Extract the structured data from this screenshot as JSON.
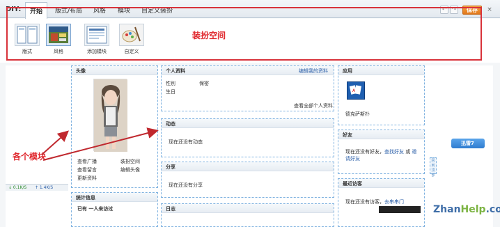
{
  "diy": {
    "label": "DIY:",
    "tabs": [
      "开始",
      "版式/布局",
      "风格",
      "模块",
      "自定义装扮"
    ],
    "save_label": "保存",
    "close_label": "×",
    "undo_label": "↶",
    "redo_label": "↷",
    "tools": [
      {
        "label": "版式",
        "icon": "layout-icon"
      },
      {
        "label": "风格",
        "icon": "style-icon"
      },
      {
        "label": "添加模块",
        "icon": "add-module-icon"
      },
      {
        "label": "自定义",
        "icon": "customize-icon"
      }
    ]
  },
  "annotations": {
    "decor_space": "装扮空间",
    "modules": "各个模块"
  },
  "left_col": {
    "avatar_title": "头像",
    "links": [
      "查看广播",
      "装扮空间",
      "查看留言",
      "编辑头像",
      "更新资料"
    ],
    "stats_title": "统计信息",
    "stats_text": "已有 一人来访过"
  },
  "mid_col": {
    "profile_title": "个人资料",
    "profile_edit": "编辑我的资料",
    "gender_label": "性别",
    "gender_value": "保密",
    "birthday_label": "生日",
    "view_all": "查看全部个人资料",
    "feed_title": "动态",
    "feed_text": "现在还没有动态",
    "share_title": "分享",
    "share_text": "现在还没有分享",
    "log_title": "日志"
  },
  "right_col": {
    "apps_title": "应用",
    "app_name": "德克萨斯扑",
    "friends_title": "好友",
    "friends_text_pre": "现在还没有好友，",
    "friends_find": "查找好友",
    "friends_or": " 或 ",
    "friends_invite": "邀请好友",
    "visitors_title": "最近访客",
    "visitors_text_pre": "现在还没有访客，",
    "visitors_link": "去串串门"
  },
  "misc": {
    "side_tab": "迅雷7",
    "scroll_widget": "回到顶部",
    "status_down": "↓ 0.1K/S",
    "status_up": "↑ 1.4K/S",
    "watermark_zhan": "Zhan",
    "watermark_help": "Help",
    "watermark_com": ".com"
  }
}
